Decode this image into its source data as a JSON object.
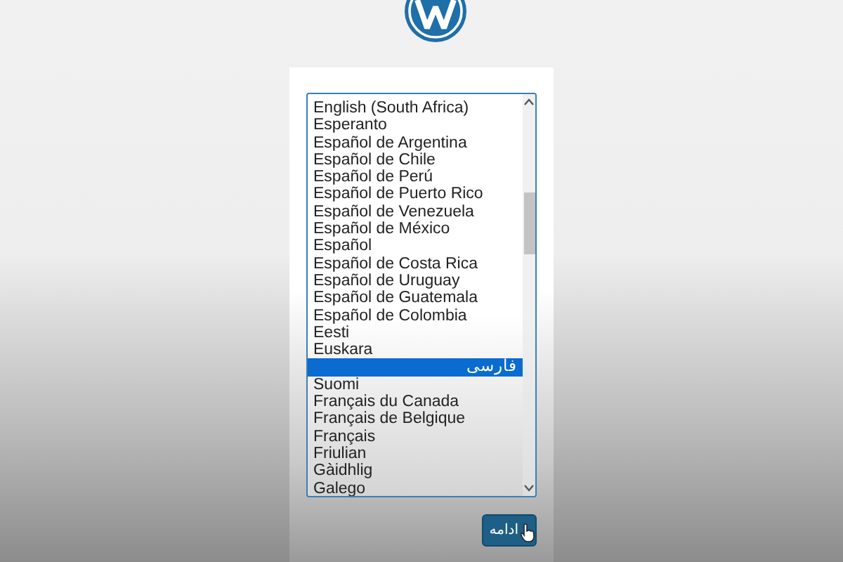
{
  "languages": [
    {
      "label": "English (South Africa)",
      "selected": false
    },
    {
      "label": "Esperanto",
      "selected": false
    },
    {
      "label": "Español de Argentina",
      "selected": false
    },
    {
      "label": "Español de Chile",
      "selected": false
    },
    {
      "label": "Español de Perú",
      "selected": false
    },
    {
      "label": "Español de Puerto Rico",
      "selected": false
    },
    {
      "label": "Español de Venezuela",
      "selected": false
    },
    {
      "label": "Español de México",
      "selected": false
    },
    {
      "label": "Español",
      "selected": false
    },
    {
      "label": "Español de Costa Rica",
      "selected": false
    },
    {
      "label": "Español de Uruguay",
      "selected": false
    },
    {
      "label": "Español de Guatemala",
      "selected": false
    },
    {
      "label": "Español de Colombia",
      "selected": false
    },
    {
      "label": "Eesti",
      "selected": false
    },
    {
      "label": "Euskara",
      "selected": false
    },
    {
      "label": "فارسی",
      "selected": true
    },
    {
      "label": "Suomi",
      "selected": false
    },
    {
      "label": "Français du Canada",
      "selected": false
    },
    {
      "label": "Français de Belgique",
      "selected": false
    },
    {
      "label": "Français",
      "selected": false
    },
    {
      "label": "Friulian",
      "selected": false
    },
    {
      "label": "Gàidhlig",
      "selected": false
    },
    {
      "label": "Galego",
      "selected": false
    }
  ],
  "continue_button": {
    "label": "ادامه"
  }
}
